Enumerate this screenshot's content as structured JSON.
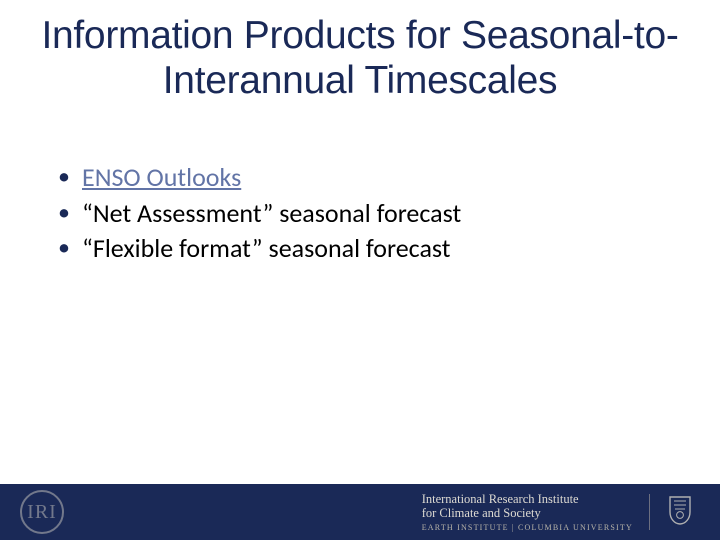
{
  "title": "Information Products for Seasonal-to-Interannual Timescales",
  "bullets": [
    {
      "text": "ENSO Outlooks",
      "is_link": true
    },
    {
      "text": "“Net Assessment” seasonal forecast",
      "is_link": false
    },
    {
      "text": "“Flexible format” seasonal forecast",
      "is_link": false
    }
  ],
  "footer": {
    "logo_text": "IRI",
    "institution_line1": "International Research Institute",
    "institution_line2": "for Climate and Society",
    "institution_line3": "EARTH INSTITUTE | COLUMBIA UNIVERSITY"
  }
}
